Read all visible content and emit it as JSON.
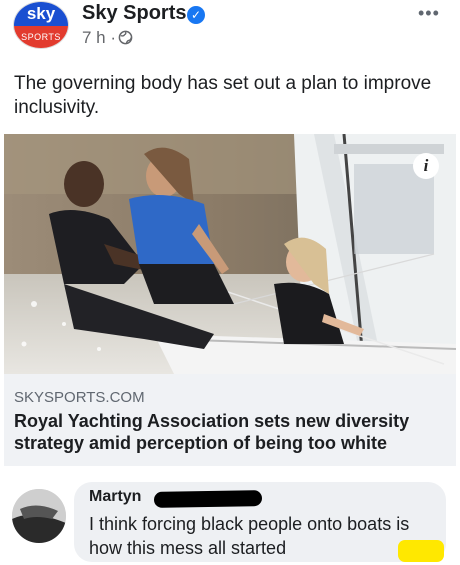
{
  "post": {
    "page_name": "Sky Sports",
    "time": "7 h ·",
    "more_icon": "more-options-icon",
    "text": "The governing body has set out a plan to improve inclusivity.",
    "avatar": {
      "top": "sky",
      "bottom": "SPORTS"
    }
  },
  "link_preview": {
    "domain": "SKYSPORTS.COM",
    "title": "Royal Yachting Association sets new diversity strategy amid perception of being too white"
  },
  "comment": {
    "author": "Martyn",
    "text": "I think forcing black people onto boats is how this mess all started"
  },
  "colors": {
    "verified": "#1877f2",
    "sky_blue": "#1a4fd1",
    "sky_red": "#e23b2e",
    "preview_bg": "#f0f2f5",
    "bubble_bg": "#eef0f3",
    "redaction_black": "#000000",
    "redaction_yellow": "#ffe800"
  }
}
